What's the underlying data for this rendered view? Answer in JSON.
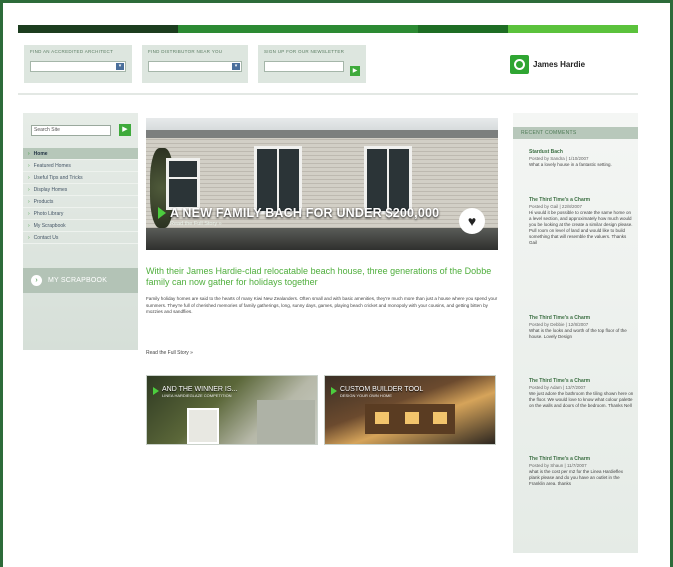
{
  "header": {
    "finders": [
      {
        "label": "FIND AN ACCREDITED ARCHITECT"
      },
      {
        "label": "FIND DISTRIBUTOR NEAR YOU"
      },
      {
        "label": "SIGN UP FOR OUR NEWSLETTER"
      }
    ],
    "logo_text": "James Hardie"
  },
  "sidebar": {
    "search_placeholder": "Search Site",
    "items": [
      {
        "label": "Home",
        "active": true
      },
      {
        "label": "Featured Homes"
      },
      {
        "label": "Useful Tips and Tricks"
      },
      {
        "label": "Display Homes"
      },
      {
        "label": "Products"
      },
      {
        "label": "Photo Library"
      },
      {
        "label": "My Scrapbook"
      },
      {
        "label": "Contact Us"
      }
    ],
    "scrapbook_label": "MY SCRAPBOOK"
  },
  "hero": {
    "title": "A NEW FAMILY BACH FOR UNDER $200,000",
    "subtitle": "Read the Full Story »"
  },
  "article": {
    "headline": "With their James Hardie-clad relocatable beach house, three generations of the Dobbe family can now gather for holidays together",
    "body": "Family holiday homes are said to the hearts of many Kiwi New Zealanders. Often small and with basic amenities, they're much more than just a house where you spend your summers. They're full of cherished memories of family gatherings, long, sunny days, games, playing beach cricket and monopoly with your cousins, and getting bitten by mozzies and sandflies.",
    "read_more": "Read the Full Story »"
  },
  "promos": [
    {
      "title": "AND THE WINNER IS...",
      "subtitle": "LINEA HARDIEGLAZE COMPETITION"
    },
    {
      "title": "CUSTOM BUILDER TOOL",
      "subtitle": "DESIGN YOUR OWN HOME"
    }
  ],
  "comments": {
    "heading": "RECENT COMMENTS",
    "items": [
      {
        "title": "Stardust Bach",
        "byline": "Posted by Sandra  |  1/10/2007",
        "text": "What a lovely house in a fantastic setting."
      },
      {
        "title": "The Third Time's a Charm",
        "byline": "Posted by Gail  |  22/8/2007",
        "text": "Hi would it be possible to create the same home on a level section, and approximately how much would you be looking at the create a similar design please. Pull room on level of land and would like to build something that will resemble the valuers. Thanks Gail"
      },
      {
        "title": "The Third Time's a Charm",
        "byline": "Posted by Debbie  |  12/8/2007",
        "text": "What is the looks and worth of the top floor of the house. Lovely Design"
      },
      {
        "title": "The Third Time's a Charm",
        "byline": "Posted by Adam  |  13/7/2007",
        "text": "We just adore the bathroom the tiling shown here on the floor. We would love to know what colour palette on the walls and doors of the bedroom. Thanks Nell"
      },
      {
        "title": "The Third Time's a Charm",
        "byline": "Posted by Shaun  |  11/7/2007",
        "text": "what is the cost per m2 for the Linea Hardieflex plank please and do you have an outlet in the Franklin area. thanks"
      }
    ]
  }
}
